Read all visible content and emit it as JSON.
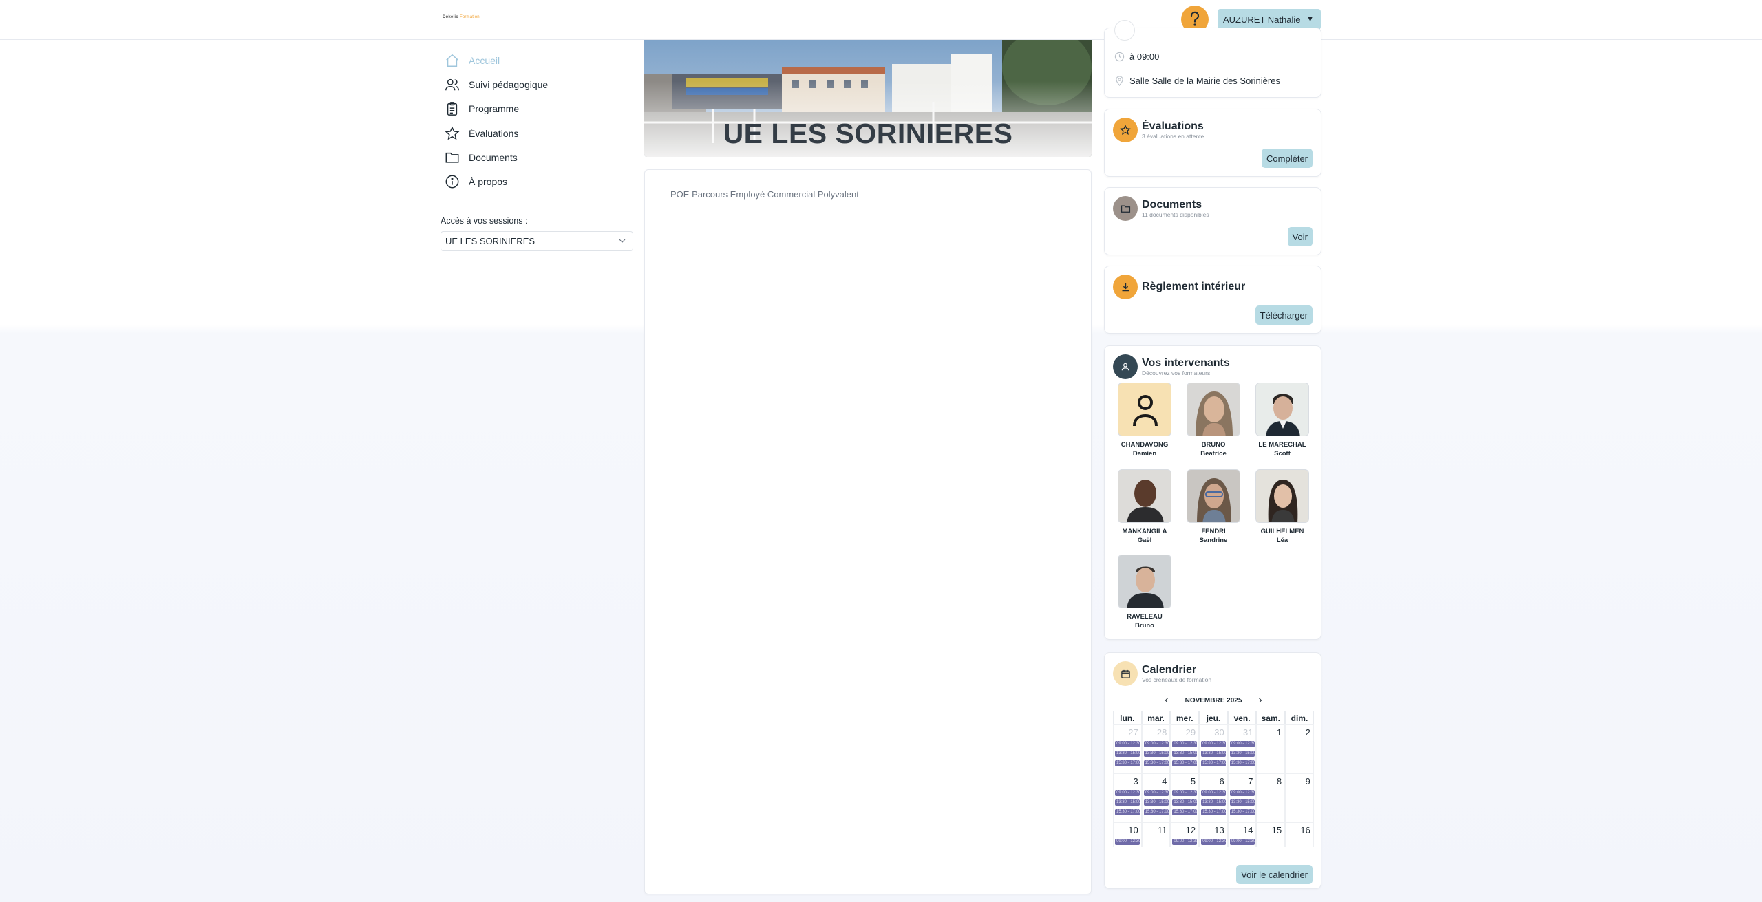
{
  "header": {
    "logo_text": "Dokelio",
    "logo_accent": "Formation",
    "user_name": "AUZURET Nathalie",
    "accent_color": "#f0a53a",
    "button_color": "#b7dbe4"
  },
  "sidebar": {
    "items": [
      {
        "label": "Accueil",
        "icon": "home-icon",
        "active": true
      },
      {
        "label": "Suivi pédagogique",
        "icon": "users-icon"
      },
      {
        "label": "Programme",
        "icon": "clipboard-icon"
      },
      {
        "label": "Évaluations",
        "icon": "star-icon"
      },
      {
        "label": "Documents",
        "icon": "folder-icon"
      },
      {
        "label": "À propos",
        "icon": "info-icon"
      }
    ],
    "sessions_label": "Accès à vos sessions :",
    "session_selected": "UE LES SORINIERES"
  },
  "main": {
    "hero_title": "UE LES SORINIERES",
    "program_title": "POE Parcours Employé Commercial Polyvalent"
  },
  "session_info": {
    "time": "à 09:00",
    "location": "Salle Salle de la Mairie des Sorinières"
  },
  "evaluations": {
    "title": "Évaluations",
    "subtitle": "3 évaluations en attente",
    "button": "Compléter"
  },
  "documents": {
    "title": "Documents",
    "subtitle": "11 documents disponibles",
    "button": "Voir"
  },
  "reglement": {
    "title": "Règlement intérieur",
    "button": "Télécharger"
  },
  "intervenants": {
    "title": "Vos intervenants",
    "subtitle": "Découvrez vos formateurs",
    "trainers": [
      {
        "last": "CHANDAVONG",
        "first": "Damien"
      },
      {
        "last": "BRUNO",
        "first": "Beatrice"
      },
      {
        "last": "LE MARECHAL",
        "first": "Scott"
      },
      {
        "last": "MANKANGILA",
        "first": "Gaël"
      },
      {
        "last": "FENDRI",
        "first": "Sandrine"
      },
      {
        "last": "GUILHELMEN",
        "first": "Léa"
      },
      {
        "last": "RAVELEAU",
        "first": "Bruno"
      }
    ]
  },
  "calendar": {
    "title": "Calendrier",
    "subtitle": "Vos créneaux de formation",
    "month": "NOVEMBRE 2025",
    "weekdays": [
      "lun.",
      "mar.",
      "mer.",
      "jeu.",
      "ven.",
      "sam.",
      "dim."
    ],
    "weeks": [
      [
        "27",
        "28",
        "29",
        "30",
        "31",
        "1",
        "2"
      ],
      [
        "3",
        "4",
        "5",
        "6",
        "7",
        "8",
        "9"
      ],
      [
        "10",
        "11",
        "12",
        "13",
        "14",
        "15",
        "16"
      ]
    ],
    "event_labels": [
      "09:00 - 12:30",
      "13:30 - 15:00",
      "15:30 - 17:00"
    ],
    "event_color": "#6f6ba8",
    "button": "Voir le calendrier"
  }
}
